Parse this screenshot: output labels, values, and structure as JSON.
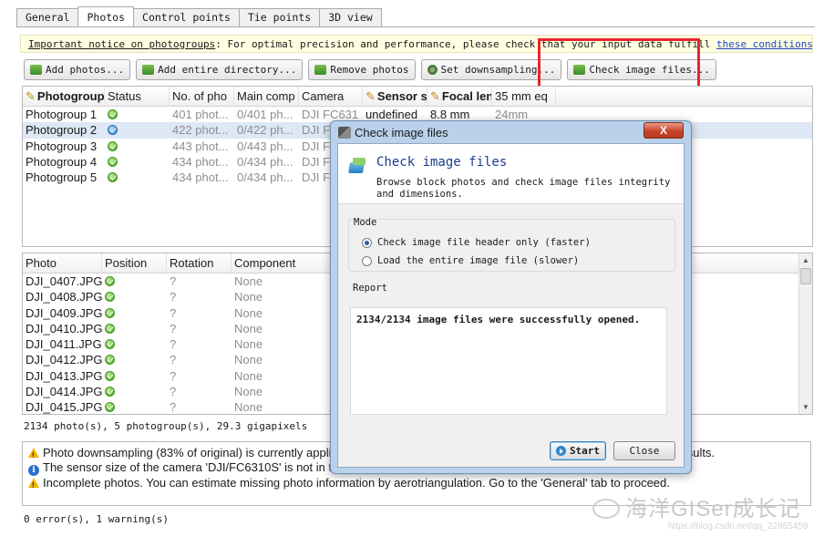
{
  "tabs": [
    {
      "label": "General",
      "active": false
    },
    {
      "label": "Photos",
      "active": true
    },
    {
      "label": "Control points",
      "active": false
    },
    {
      "label": "Tie points",
      "active": false
    },
    {
      "label": "3D view",
      "active": false
    }
  ],
  "notice": {
    "link_text": "Important notice on photogroups",
    "text": ": For optimal precision and performance, please check that your input data fulfill ",
    "link2_text": "these conditions",
    "end": "."
  },
  "toolbar": {
    "add_photos": "Add photos...",
    "add_directory": "Add entire directory...",
    "remove_photos": "Remove photos",
    "set_downsampling": "Set downsampling...",
    "check_image_files": "Check image files..."
  },
  "photogroups": {
    "columns": [
      "Photogroup",
      "Status",
      "No. of pho",
      "Main comp",
      "Camera",
      "Sensor si",
      "Focal len",
      "35 mm eq"
    ],
    "rows": [
      {
        "name": "Photogroup 1",
        "photos": "401 phot...",
        "main": "0/401 ph...",
        "camera": "DJI FC631",
        "sensor": "undefined",
        "focal": "8.8 mm",
        "eq": "24mm",
        "selected": false,
        "status_color": "green"
      },
      {
        "name": "Photogroup 2",
        "photos": "422 phot...",
        "main": "0/422 ph...",
        "camera": "DJI FC",
        "sensor": "",
        "focal": "",
        "eq": "",
        "selected": true,
        "status_color": "blue"
      },
      {
        "name": "Photogroup 3",
        "photos": "443 phot...",
        "main": "0/443 ph...",
        "camera": "DJI FC",
        "sensor": "",
        "focal": "",
        "eq": "",
        "selected": false,
        "status_color": "green"
      },
      {
        "name": "Photogroup 4",
        "photos": "434 phot...",
        "main": "0/434 ph...",
        "camera": "DJI FC",
        "sensor": "",
        "focal": "",
        "eq": "",
        "selected": false,
        "status_color": "green"
      },
      {
        "name": "Photogroup 5",
        "photos": "434 phot...",
        "main": "0/434 ph...",
        "camera": "DJI FC",
        "sensor": "",
        "focal": "",
        "eq": "",
        "selected": false,
        "status_color": "green"
      }
    ]
  },
  "photos": {
    "columns": [
      "Photo",
      "Position",
      "Rotation",
      "Component"
    ],
    "rows": [
      {
        "name": "DJI_0407.JPG",
        "rotation": "?",
        "component": "None"
      },
      {
        "name": "DJI_0408.JPG",
        "rotation": "?",
        "component": "None"
      },
      {
        "name": "DJI_0409.JPG",
        "rotation": "?",
        "component": "None"
      },
      {
        "name": "DJI_0410.JPG",
        "rotation": "?",
        "component": "None"
      },
      {
        "name": "DJI_0411.JPG",
        "rotation": "?",
        "component": "None"
      },
      {
        "name": "DJI_0412.JPG",
        "rotation": "?",
        "component": "None"
      },
      {
        "name": "DJI_0413.JPG",
        "rotation": "?",
        "component": "None"
      },
      {
        "name": "DJI_0414.JPG",
        "rotation": "?",
        "component": "None"
      },
      {
        "name": "DJI_0415.JPG",
        "rotation": "?",
        "component": "None"
      }
    ]
  },
  "summary": "2134 photo(s), 5 photogroup(s), 29.3 gigapixels",
  "messages": {
    "m1_a": "Photo downsampling (83% of original) is currently appli",
    "m1_b": "esults.",
    "m2": "The sensor size of the camera 'DJI/FC6310S' is not in the",
    "m3": "Incomplete photos. You can estimate missing photo information by aerotriangulation. Go to the 'General' tab to proceed."
  },
  "footer": "0 error(s), 1 warning(s)",
  "watermark": {
    "text": "海洋GISer成长记",
    "url": "https://blog.csdn.net/qq_22865459"
  },
  "dialog": {
    "title": "Check image files",
    "close": "X",
    "header_title": "Check image files",
    "header_desc": "Browse block photos and check image files integrity and dimensions.",
    "mode_label": "Mode",
    "option1": "Check image file header only (faster)",
    "option2": "Load the entire image file (slower)",
    "option1_selected": true,
    "report_label": "Report",
    "report_text": "2134/2134 image files were successfully opened.",
    "start": "Start",
    "close_btn": "Close"
  }
}
